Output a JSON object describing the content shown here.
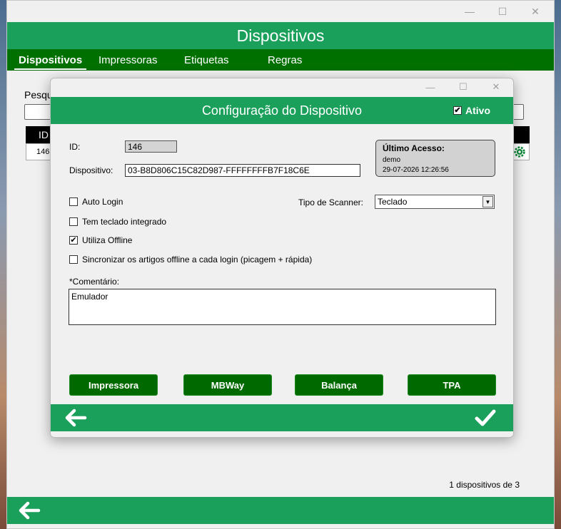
{
  "main": {
    "title": "Dispositivos",
    "tabs": [
      {
        "label": "Dispositivos",
        "active": true
      },
      {
        "label": "Impressoras"
      },
      {
        "label": "Etiquetas"
      },
      {
        "label": "Regras"
      }
    ],
    "search_label": "Pesqu",
    "table": {
      "col_id": "ID",
      "rows": [
        {
          "id": "146"
        }
      ]
    },
    "footer_count": "1 dispositivos de 3"
  },
  "dialog": {
    "title": "Configuração do Dispositivo",
    "ativo_label": "Ativo",
    "ativo_checked": true,
    "id_label": "ID:",
    "id_value": "146",
    "device_label": "Dispositivo:",
    "device_value": "03-B8D806C15C82D987-FFFFFFFFB7F18C6E",
    "last_access": {
      "title": "Último Acesso:",
      "user": "demo",
      "date": "29-07-2026 12:26:56"
    },
    "checks": [
      {
        "label": "Auto Login",
        "checked": false
      },
      {
        "label": "Tem teclado integrado",
        "checked": false
      },
      {
        "label": "Utiliza Offline",
        "checked": true
      },
      {
        "label": "Sincronizar os artigos offline a cada login (picagem + rápida)",
        "checked": false
      }
    ],
    "scanner_label": "Tipo de Scanner:",
    "scanner_value": "Teclado",
    "comment_label": "*Comentário:",
    "comment_value": "Emulador",
    "buttons": [
      "Impressora",
      "MBWay",
      "Balança",
      "TPA"
    ]
  },
  "colors": {
    "green": "#1aa05a",
    "dark_green": "#007000",
    "button_green": "#006a00"
  }
}
